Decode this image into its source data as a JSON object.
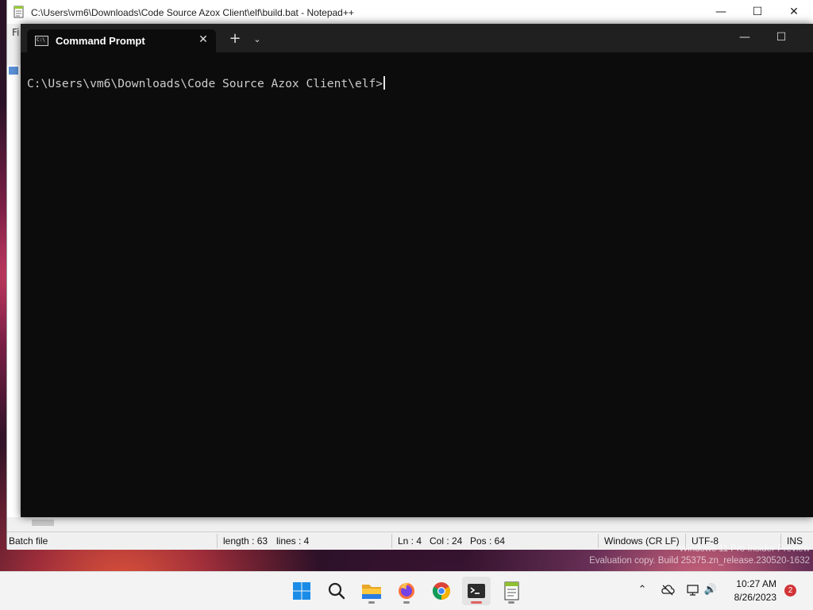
{
  "notepad": {
    "title": "C:\\Users\\vm6\\Downloads\\Code Source Azox Client\\elf\\build.bat - Notepad++",
    "menu_fragment": "Fi",
    "status": {
      "file_type": "Batch file",
      "length": "length : 63",
      "lines": "lines : 4",
      "ln": "Ln : 4",
      "col": "Col : 24",
      "pos": "Pos : 64",
      "eol": "Windows (CR LF)",
      "encoding": "UTF-8",
      "mode": "INS"
    },
    "controls": {
      "minimize": "—",
      "maximize": "☐",
      "close": "✕"
    }
  },
  "terminal": {
    "tab_label": "Command Prompt",
    "tab_icon_text": "C:\\",
    "tab_close": "✕",
    "new_tab": "+",
    "dropdown": "⌄",
    "controls": {
      "minimize": "—",
      "maximize": "☐"
    },
    "prompt": "C:\\Users\\vm6\\Downloads\\Code Source Azox Client\\elf>"
  },
  "watermark": {
    "line1": "Windows 11 Pro Insider Preview",
    "line2": "Evaluation copy. Build 25375.zn_release.230520-1632"
  },
  "taskbar": {
    "apps": [
      "windows-start",
      "search",
      "file-explorer",
      "firefox",
      "chrome",
      "terminal",
      "notepad-plus-plus"
    ],
    "active_app": "terminal",
    "time": "10:27 AM",
    "date": "8/26/2023",
    "notifications": "2",
    "tray": {
      "chevron": "⌃",
      "network": "⊘",
      "volume": "🔊"
    }
  },
  "colors": {
    "terminal_bg": "#0c0c0c",
    "terminal_titlebar": "#202020",
    "terminal_text": "#cccccc",
    "taskbar_bg": "#f3f3f3",
    "badge": "#d13438"
  }
}
